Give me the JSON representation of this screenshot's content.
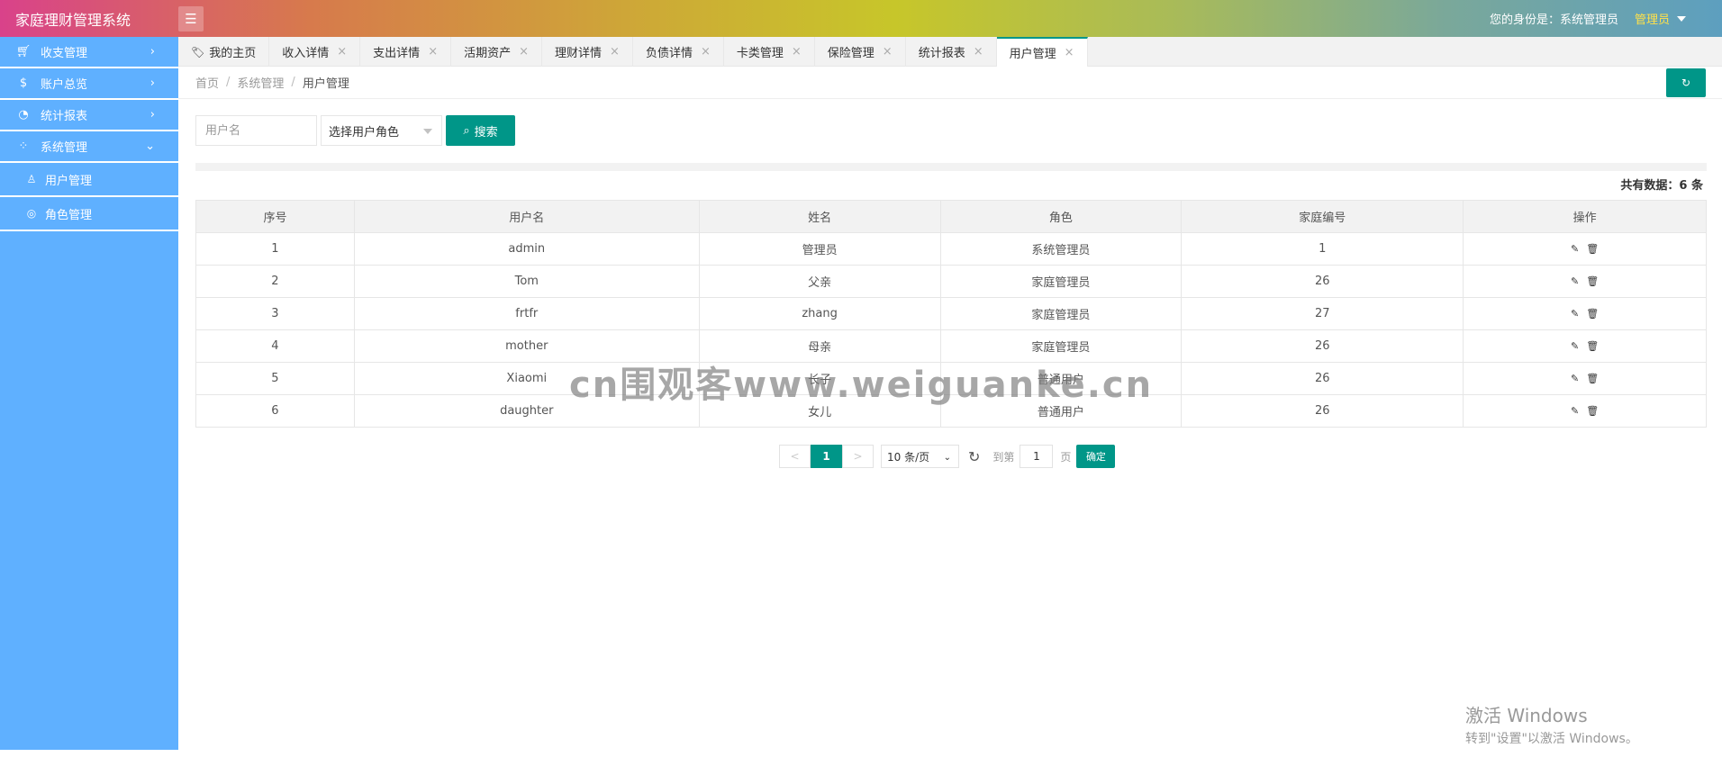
{
  "header": {
    "app_title": "家庭理财管理系统",
    "menu_icon": "hamburger-icon",
    "identity_text": "您的身份是：系统管理员",
    "user_menu_label": "管理员",
    "accent_color": "#009688",
    "user_menu_color": "#ffe14a"
  },
  "sidebar": {
    "background": "#5fb0ff",
    "items": [
      {
        "label": "收支管理",
        "icon": "cart-icon"
      },
      {
        "label": "账户总览",
        "icon": "dollar-icon"
      },
      {
        "label": "统计报表",
        "icon": "chart-icon"
      },
      {
        "label": "系统管理",
        "icon": "apps-icon",
        "expanded": true
      }
    ],
    "sub_items": [
      {
        "label": "用户管理",
        "icon": "user-icon"
      },
      {
        "label": "角色管理",
        "icon": "role-icon"
      }
    ]
  },
  "tabs": [
    {
      "label": "我的主页",
      "closable": false
    },
    {
      "label": "收入详情"
    },
    {
      "label": "支出详情"
    },
    {
      "label": "活期资产"
    },
    {
      "label": "理财详情"
    },
    {
      "label": "负债详情"
    },
    {
      "label": "卡类管理"
    },
    {
      "label": "保险管理"
    },
    {
      "label": "统计报表"
    },
    {
      "label": "用户管理",
      "active": true
    }
  ],
  "breadcrumb": [
    "首页",
    "系统管理",
    "用户管理"
  ],
  "search": {
    "username_placeholder": "用户名",
    "role_select_label": "选择用户角色",
    "search_button": "搜索"
  },
  "total_text": "共有数据：6 条",
  "table": {
    "headers": [
      "序号",
      "用户名",
      "姓名",
      "角色",
      "家庭编号",
      "操作"
    ],
    "rows": [
      [
        "1",
        "admin",
        "管理员",
        "系统管理员",
        "1"
      ],
      [
        "2",
        "Tom",
        "父亲",
        "家庭管理员",
        "26"
      ],
      [
        "3",
        "frtfr",
        "zhang",
        "家庭管理员",
        "27"
      ],
      [
        "4",
        "mother",
        "母亲",
        "家庭管理员",
        "26"
      ],
      [
        "5",
        "Xiaomi",
        "长子",
        "普通用户",
        "26"
      ],
      [
        "6",
        "daughter",
        "女儿",
        "普通用户",
        "26"
      ]
    ]
  },
  "pager": {
    "prev": "<",
    "current": "1",
    "next": ">",
    "page_size": "10 条/页",
    "goto_label": "到第",
    "goto_value": "1",
    "page_label": "页",
    "ok": "确定"
  },
  "watermark": "cn围观客www.weiguanke.cn",
  "windows_activation": {
    "line1": "激活 Windows",
    "line2": "转到\"设置\"以激活 Windows。"
  }
}
